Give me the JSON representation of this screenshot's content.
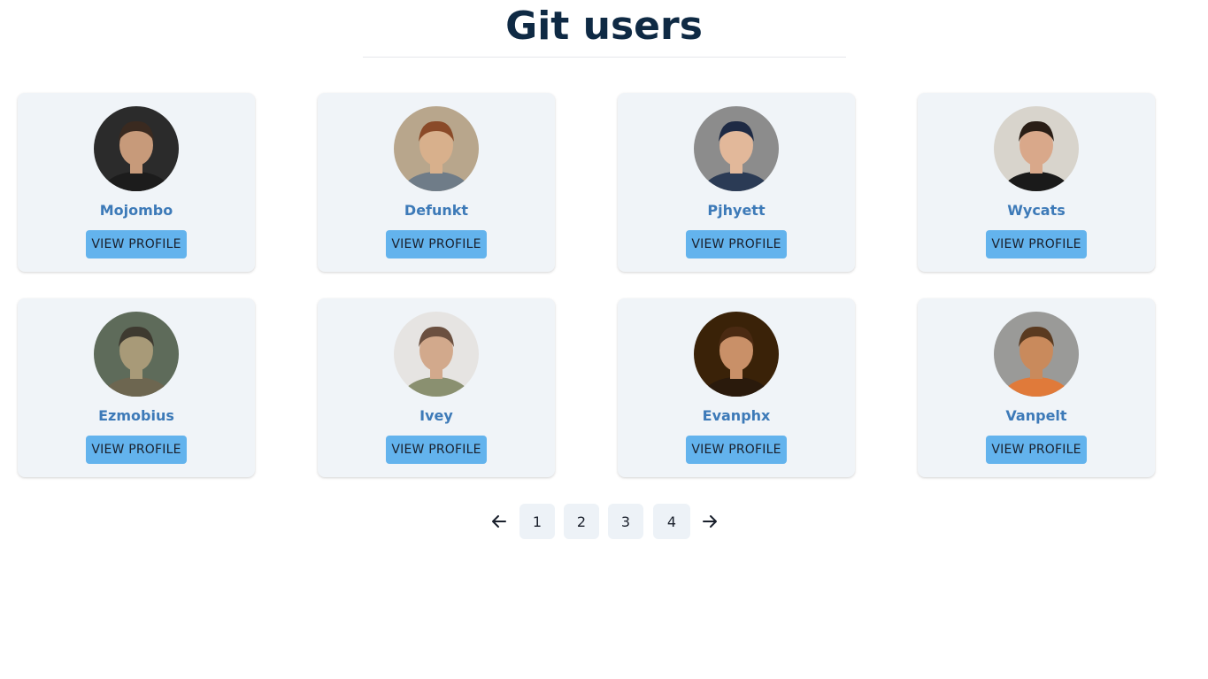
{
  "header": {
    "title": "Git users"
  },
  "users": [
    {
      "name": "Mojombo",
      "button": "VIEW PROFILE",
      "avatar_bg": "#2b2b2b",
      "avatar_skin": "#c79a7a",
      "avatar_hair": "#3a2a20",
      "avatar_shirt": "#1c1c1c"
    },
    {
      "name": "Defunkt",
      "button": "VIEW PROFILE",
      "avatar_bg": "#b8a68c",
      "avatar_skin": "#d8b08c",
      "avatar_hair": "#8a4a28",
      "avatar_shirt": "#6f7c88"
    },
    {
      "name": "Pjhyett",
      "button": "VIEW PROFILE",
      "avatar_bg": "#8c8c8c",
      "avatar_skin": "#e2b89a",
      "avatar_hair": "#1e2a44",
      "avatar_shirt": "#2b3b55"
    },
    {
      "name": "Wycats",
      "button": "VIEW PROFILE",
      "avatar_bg": "#d8d4cc",
      "avatar_skin": "#d9a88a",
      "avatar_hair": "#2a1e16",
      "avatar_shirt": "#1a1a1a"
    },
    {
      "name": "Ezmobius",
      "button": "VIEW PROFILE",
      "avatar_bg": "#5e6b5a",
      "avatar_skin": "#a89a78",
      "avatar_hair": "#3e3a30",
      "avatar_shirt": "#6d6650"
    },
    {
      "name": "Ivey",
      "button": "VIEW PROFILE",
      "avatar_bg": "#e6e4e2",
      "avatar_skin": "#d2a98c",
      "avatar_hair": "#6b5040",
      "avatar_shirt": "#8a9070"
    },
    {
      "name": "Evanphx",
      "button": "VIEW PROFILE",
      "avatar_bg": "#3a2208",
      "avatar_skin": "#c99068",
      "avatar_hair": "#4a2a12",
      "avatar_shirt": "#2a1a0c"
    },
    {
      "name": "Vanpelt",
      "button": "VIEW PROFILE",
      "avatar_bg": "#9a9a98",
      "avatar_skin": "#c98a5c",
      "avatar_hair": "#5a3a20",
      "avatar_shirt": "#e07a3a"
    }
  ],
  "pagination": {
    "pages": [
      "1",
      "2",
      "3",
      "4"
    ],
    "prev_icon": "arrow-left-icon",
    "next_icon": "arrow-right-icon"
  },
  "colors": {
    "title": "#0f2a44",
    "card_bg": "#f0f4f8",
    "username": "#3d7ab8",
    "button_bg": "#63b3ed",
    "page_btn_bg": "#edf2f7"
  }
}
